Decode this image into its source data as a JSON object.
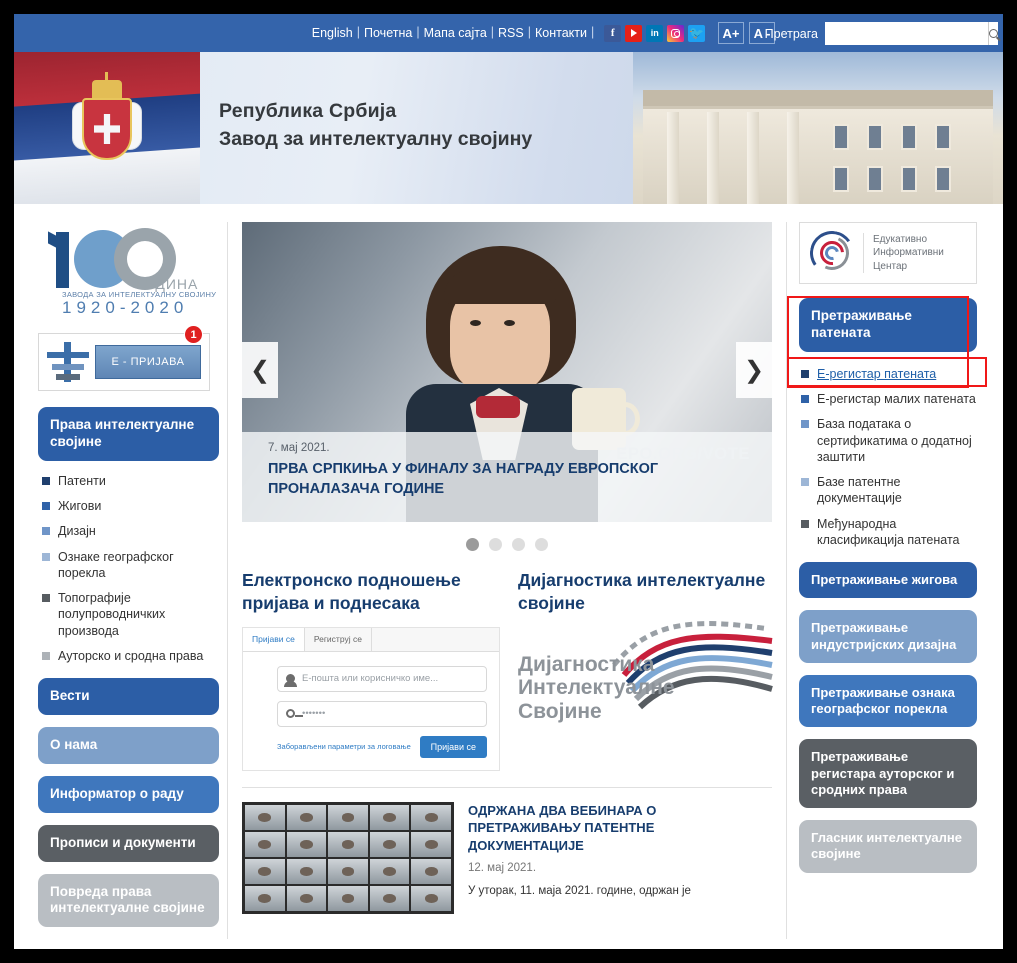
{
  "topbar": {
    "links": [
      "English",
      "Почетна",
      "Мапа сајта",
      "RSS",
      "Контакти"
    ],
    "social": [
      {
        "name": "facebook-icon",
        "glyph": "f"
      },
      {
        "name": "youtube-icon",
        "glyph": "▶"
      },
      {
        "name": "linkedin-icon",
        "glyph": "in"
      },
      {
        "name": "instagram-icon",
        "glyph": "◎"
      },
      {
        "name": "twitter-icon",
        "glyph": "🐦"
      }
    ],
    "font_increase": "A+",
    "font_decrease": "A -",
    "search_label": "Претрага",
    "search_value": "",
    "search_placeholder": ""
  },
  "banner": {
    "line1": "Република Србија",
    "line2": "Завод за  интелектуалну својину"
  },
  "anniversary": {
    "number": "100",
    "godina": "ГОДИНА",
    "subtitle": "ЗАВОДА ЗА ИНТЕЛЕКТУАЛНУ СВОЈИНУ",
    "years": "1920-2020"
  },
  "eprijava": {
    "label": "Е - ПРИЈАВА",
    "badge": "1"
  },
  "left_sidebar": {
    "section_title": "Права интелектуалне својине",
    "items": [
      {
        "label": "Патенти",
        "color": "#1f3f6e"
      },
      {
        "label": "Жигови",
        "color": "#2f62a8"
      },
      {
        "label": "Дизајн",
        "color": "#6f95c8"
      },
      {
        "label": "Ознаке географског порекла",
        "color": "#9db6d6"
      },
      {
        "label": "Топографије полупроводничких производа",
        "color": "#575c61"
      },
      {
        "label": "Ауторско и сродна права",
        "color": "#adb2b7"
      }
    ],
    "buttons": [
      {
        "label": "Вести",
        "color": "#2c5ea6"
      },
      {
        "label": "О нама",
        "color": "#7ea0c9"
      },
      {
        "label": "Информатор о раду",
        "color": "#3f77bd"
      },
      {
        "label": "Прописи и документи",
        "color": "#5a5f64"
      },
      {
        "label": "Повреда права интелектуалне својине",
        "color": "#b9bec3"
      }
    ]
  },
  "carousel": {
    "date": "7. мај 2021.",
    "title": "ПРВА СРПКИЊА У ФИНАЛУ ЗА НАГРАДУ ЕВРОПСКОГ ПРОНАЛАЗАЧА ГОДИНЕ",
    "watermark": "EPO.ORG/VOTE",
    "prev": "❮",
    "next": "❯",
    "slides": 4,
    "active_slide": 1
  },
  "esubmission": {
    "heading": "Електронско подношење пријава и поднесака",
    "tab_login": "Пријави се",
    "tab_register": "Региструј се",
    "user_placeholder": "Е-пошта или корисничко име...",
    "password_value": "•••••••",
    "forgot_link": "Заборављени параметри за логовање",
    "submit": "Пријави се"
  },
  "diagnostics": {
    "heading": "Дијагностика интелектуалне својине",
    "logo_line1": "Дијагностика",
    "logo_line2": "Интелектуалне",
    "logo_line3": "Својине"
  },
  "news": {
    "title": "ОДРЖАНА ДВА ВЕБИНАРА О ПРЕТРАЖИВАЊУ ПАТЕНТНЕ ДОКУМЕНТАЦИЈЕ",
    "date": "12. мај 2021.",
    "excerpt": "У уторак, 11. маја 2021. године, одржан је"
  },
  "right_sidebar": {
    "eic": {
      "line1": "Едукативно",
      "line2": "Информативни",
      "line3": "Центар"
    },
    "patent_search_button": "Претраживање патената",
    "patent_links": [
      {
        "label": "Е-регистар патената",
        "color": "#1f3f6e",
        "highlighted": true
      },
      {
        "label": "Е-регистар малих патената",
        "color": "#2f62a8",
        "highlighted": false
      },
      {
        "label": "База података о сертификатима о додатној заштити",
        "color": "#6f95c8",
        "highlighted": false
      },
      {
        "label": "Базе патентне документације",
        "color": "#9db6d6",
        "highlighted": false
      },
      {
        "label": "Међународна класификација патената",
        "color": "#575c61",
        "highlighted": false
      }
    ],
    "buttons": [
      {
        "label": "Претраживање жигова",
        "color": "#2c5ea6"
      },
      {
        "label": "Претраживање индустријских дизајна",
        "color": "#7ea0c9"
      },
      {
        "label": "Претраживање ознака географског порекла",
        "color": "#3f77bd"
      },
      {
        "label": "Претраживање регистара ауторског и сродних права",
        "color": "#5a5f64"
      },
      {
        "label": "Гласник интелектуалне својине",
        "color": "#b9bec3"
      }
    ]
  },
  "highlight_color": "#f01818"
}
